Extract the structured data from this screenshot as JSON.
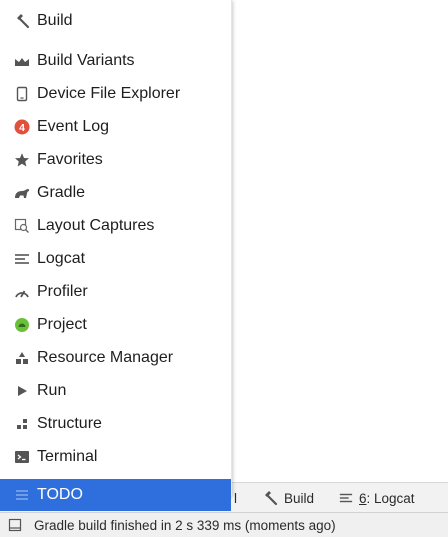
{
  "menu": {
    "items": [
      {
        "label": "Build",
        "icon": "hammer-icon"
      },
      {
        "label": "Build Variants",
        "icon": "build-variants-icon"
      },
      {
        "label": "Device File Explorer",
        "icon": "device-icon"
      },
      {
        "label": "Event Log",
        "icon": "event-log-error-icon",
        "badge": "4"
      },
      {
        "label": "Favorites",
        "icon": "star-icon"
      },
      {
        "label": "Gradle",
        "icon": "gradle-elephant-icon"
      },
      {
        "label": "Layout Captures",
        "icon": "layout-captures-icon"
      },
      {
        "label": "Logcat",
        "icon": "logcat-icon"
      },
      {
        "label": "Profiler",
        "icon": "profiler-gauge-icon"
      },
      {
        "label": "Project",
        "icon": "project-android-icon"
      },
      {
        "label": "Resource Manager",
        "icon": "resource-manager-icon"
      },
      {
        "label": "Run",
        "icon": "run-play-icon"
      },
      {
        "label": "Structure",
        "icon": "structure-icon"
      },
      {
        "label": "Terminal",
        "icon": "terminal-icon"
      },
      {
        "label": "TODO",
        "icon": "todo-list-icon",
        "selected": true
      }
    ]
  },
  "toolbar": {
    "hidden_fragment": "l",
    "build_label": "Build",
    "logcat_num": "6",
    "logcat_label": ": Logcat"
  },
  "status": {
    "message": "Gradle build finished in 2 s 339 ms (moments ago)"
  },
  "colors": {
    "selection": "#2f6fdd",
    "event_log_badge": "#e0503c",
    "project_icon": "#6cbf3a"
  }
}
